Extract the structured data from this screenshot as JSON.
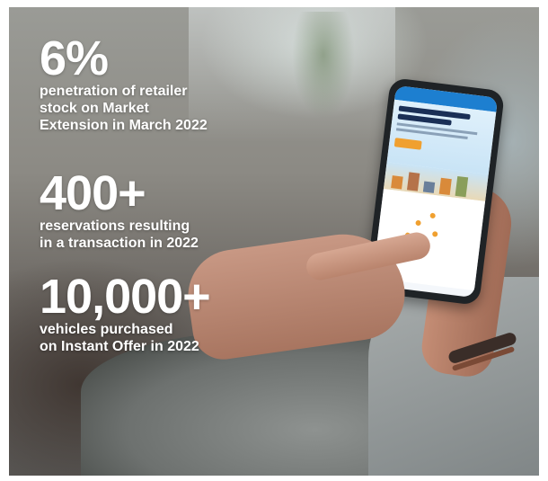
{
  "stats": [
    {
      "value": "6%",
      "description": "penetration of retailer\nstock on Market\nExtension in March 2022"
    },
    {
      "value": "400+",
      "description": "reservations resulting\nin a transaction in 2022"
    },
    {
      "value": "10,000+",
      "description": "vehicles purchased\non Instant Offer in 2022"
    }
  ],
  "phone_screen": {
    "brand_color": "#1d7fd0",
    "cta_color": "#f0a030"
  },
  "colors": {
    "text": "#ffffff"
  }
}
